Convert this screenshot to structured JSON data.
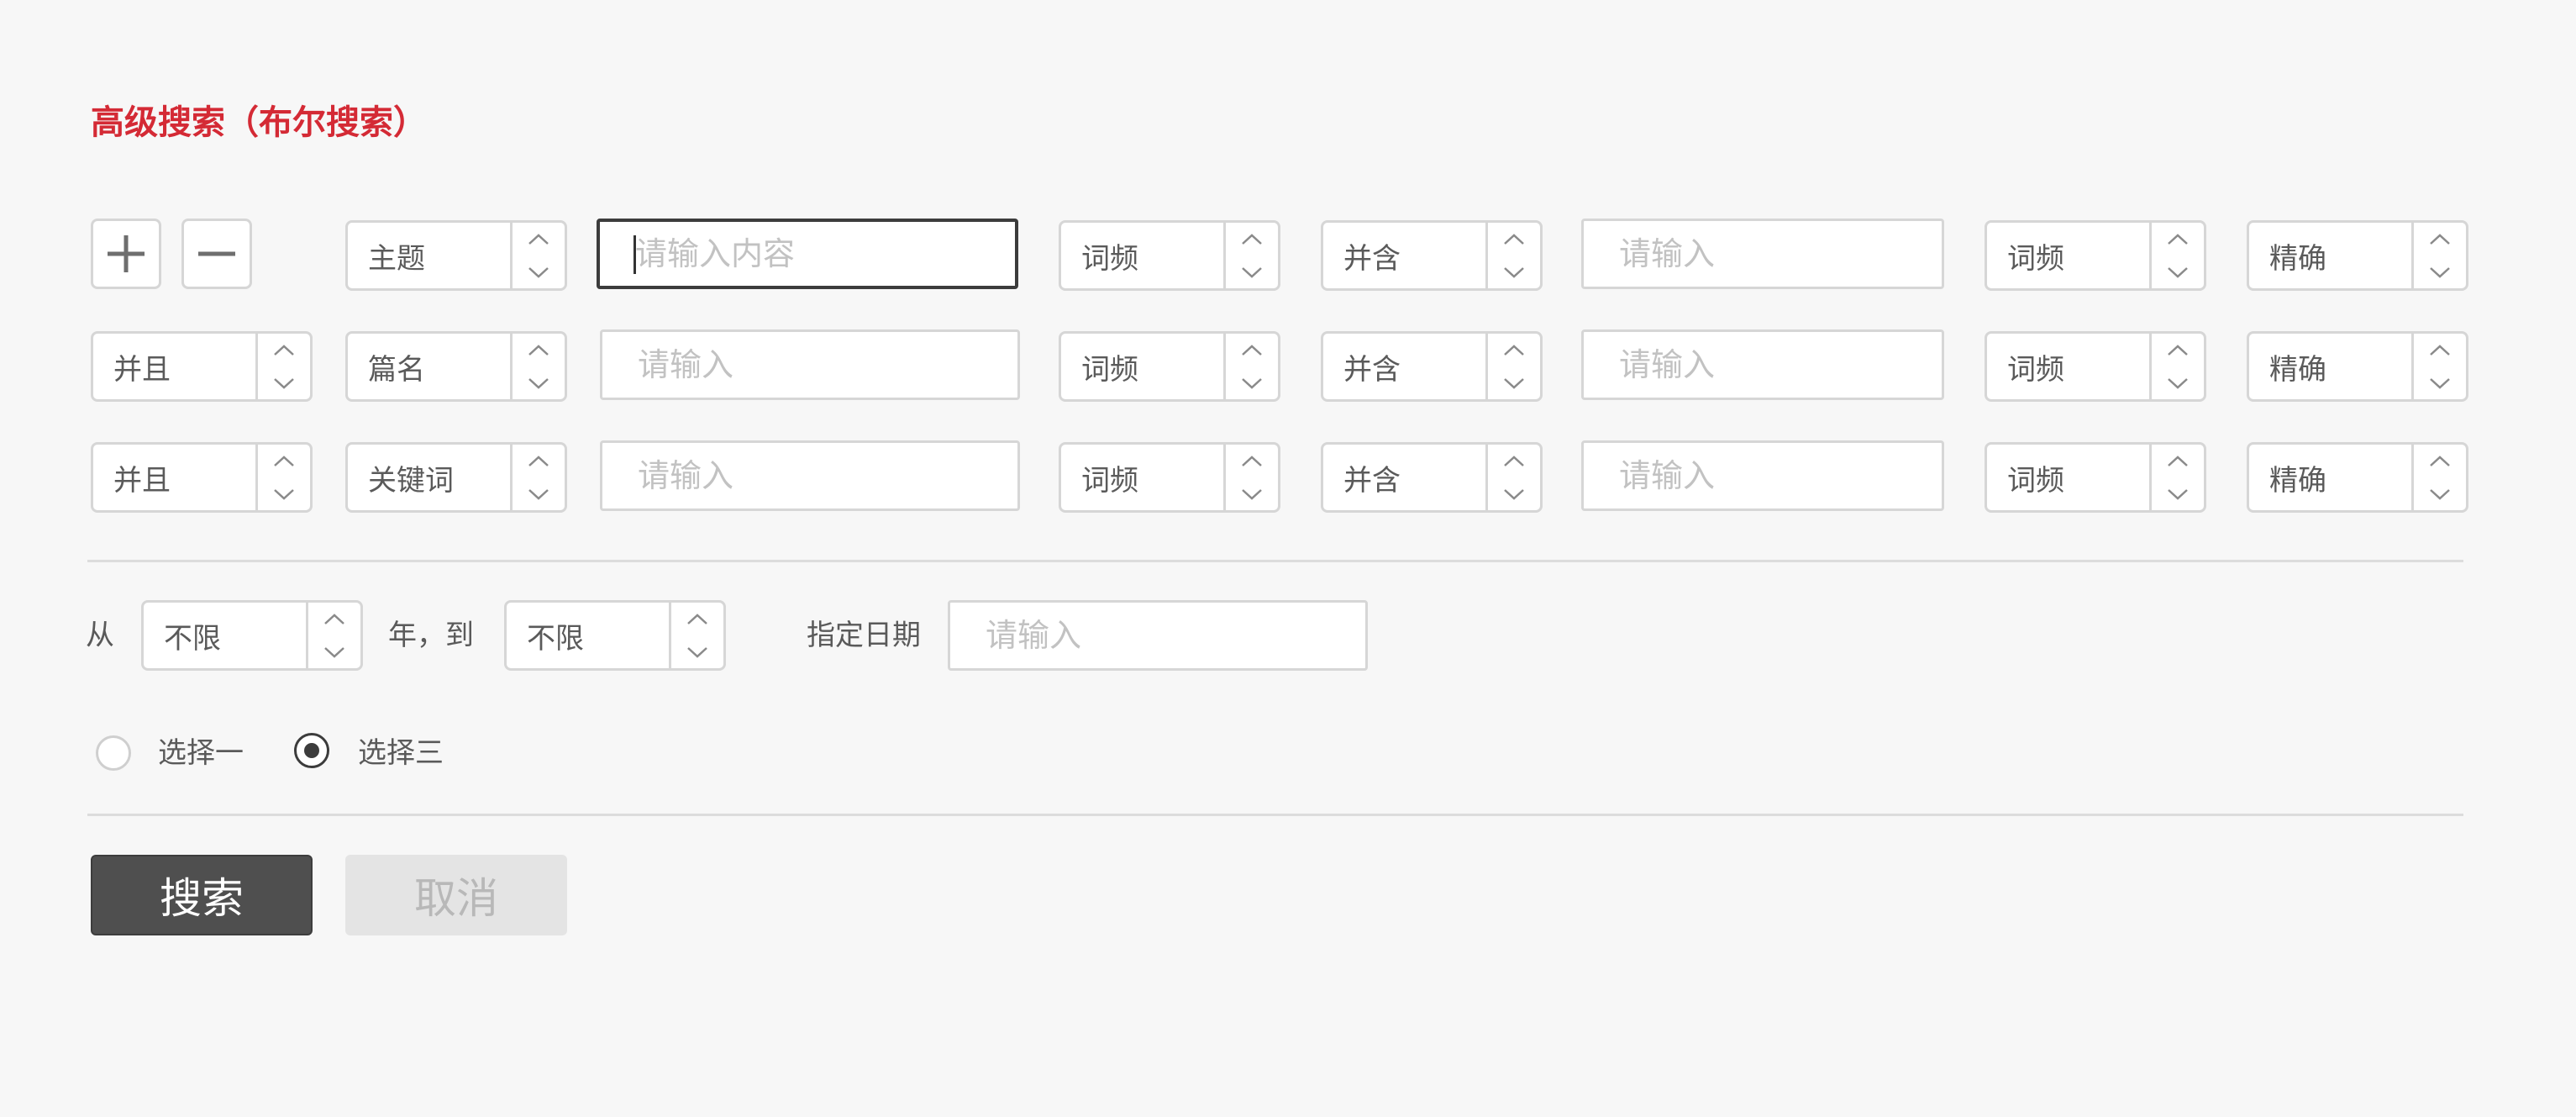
{
  "title": "高级搜索（布尔搜索）",
  "toolbar": {
    "add_icon": "plus-icon",
    "remove_icon": "minus-icon"
  },
  "rows": [
    {
      "logic": null,
      "field": "主题",
      "term1_placeholder": "请输入内容",
      "freq1": "词频",
      "combine": "并含",
      "term2_placeholder": "请输入",
      "freq2": "词频",
      "match": "精确"
    },
    {
      "logic": "并且",
      "field": "篇名",
      "term1_placeholder": "请输入",
      "freq1": "词频",
      "combine": "并含",
      "term2_placeholder": "请输入",
      "freq2": "词频",
      "match": "精确"
    },
    {
      "logic": "并且",
      "field": "关键词",
      "term1_placeholder": "请输入",
      "freq1": "词频",
      "combine": "并含",
      "term2_placeholder": "请输入",
      "freq2": "词频",
      "match": "精确"
    }
  ],
  "date": {
    "from_label": "从",
    "from_value": "不限",
    "to_label": "年，到",
    "to_value": "不限",
    "specified_label": "指定日期",
    "specified_placeholder": "请输入"
  },
  "options": [
    {
      "label": "选择一",
      "checked": false
    },
    {
      "label": "选择三",
      "checked": true
    }
  ],
  "actions": {
    "search_label": "搜索",
    "cancel_label": "取消"
  },
  "colors": {
    "accent": "#d42a35",
    "primary_button": "#4f4f4f",
    "disabled_button": "#e4e4e4",
    "border": "#d6d6d6",
    "background": "#f7f7f7"
  }
}
